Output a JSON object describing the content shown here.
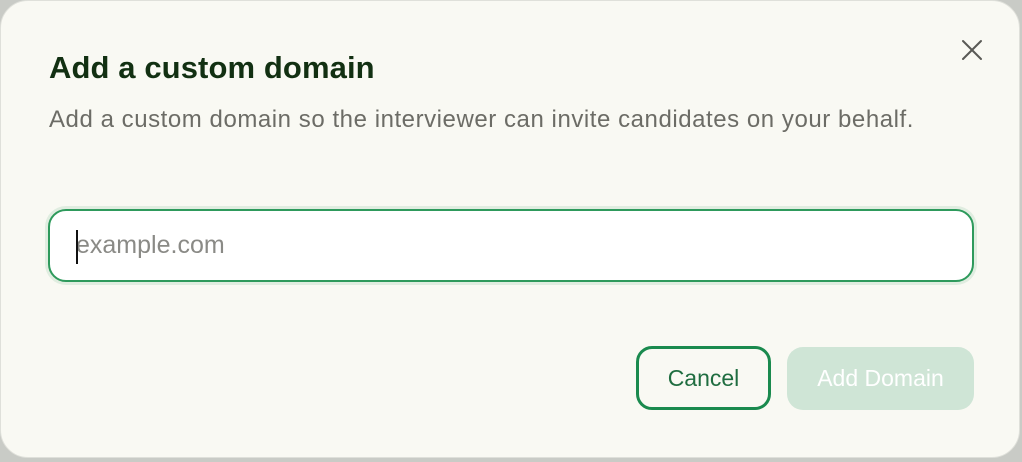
{
  "dialog": {
    "title": "Add a custom domain",
    "description": "Add a custom domain so the interviewer can invite candidates on your behalf.",
    "close_icon": "close-icon"
  },
  "domain_input": {
    "value": "",
    "placeholder": "example.com"
  },
  "actions": {
    "cancel_label": "Cancel",
    "add_label": "Add Domain",
    "add_disabled": true
  },
  "colors": {
    "accent": "#1a8a4e",
    "title": "#123012",
    "body_text": "#6c6c66",
    "disabled_button": "#cfe5d6",
    "background": "#f9f9f3"
  }
}
